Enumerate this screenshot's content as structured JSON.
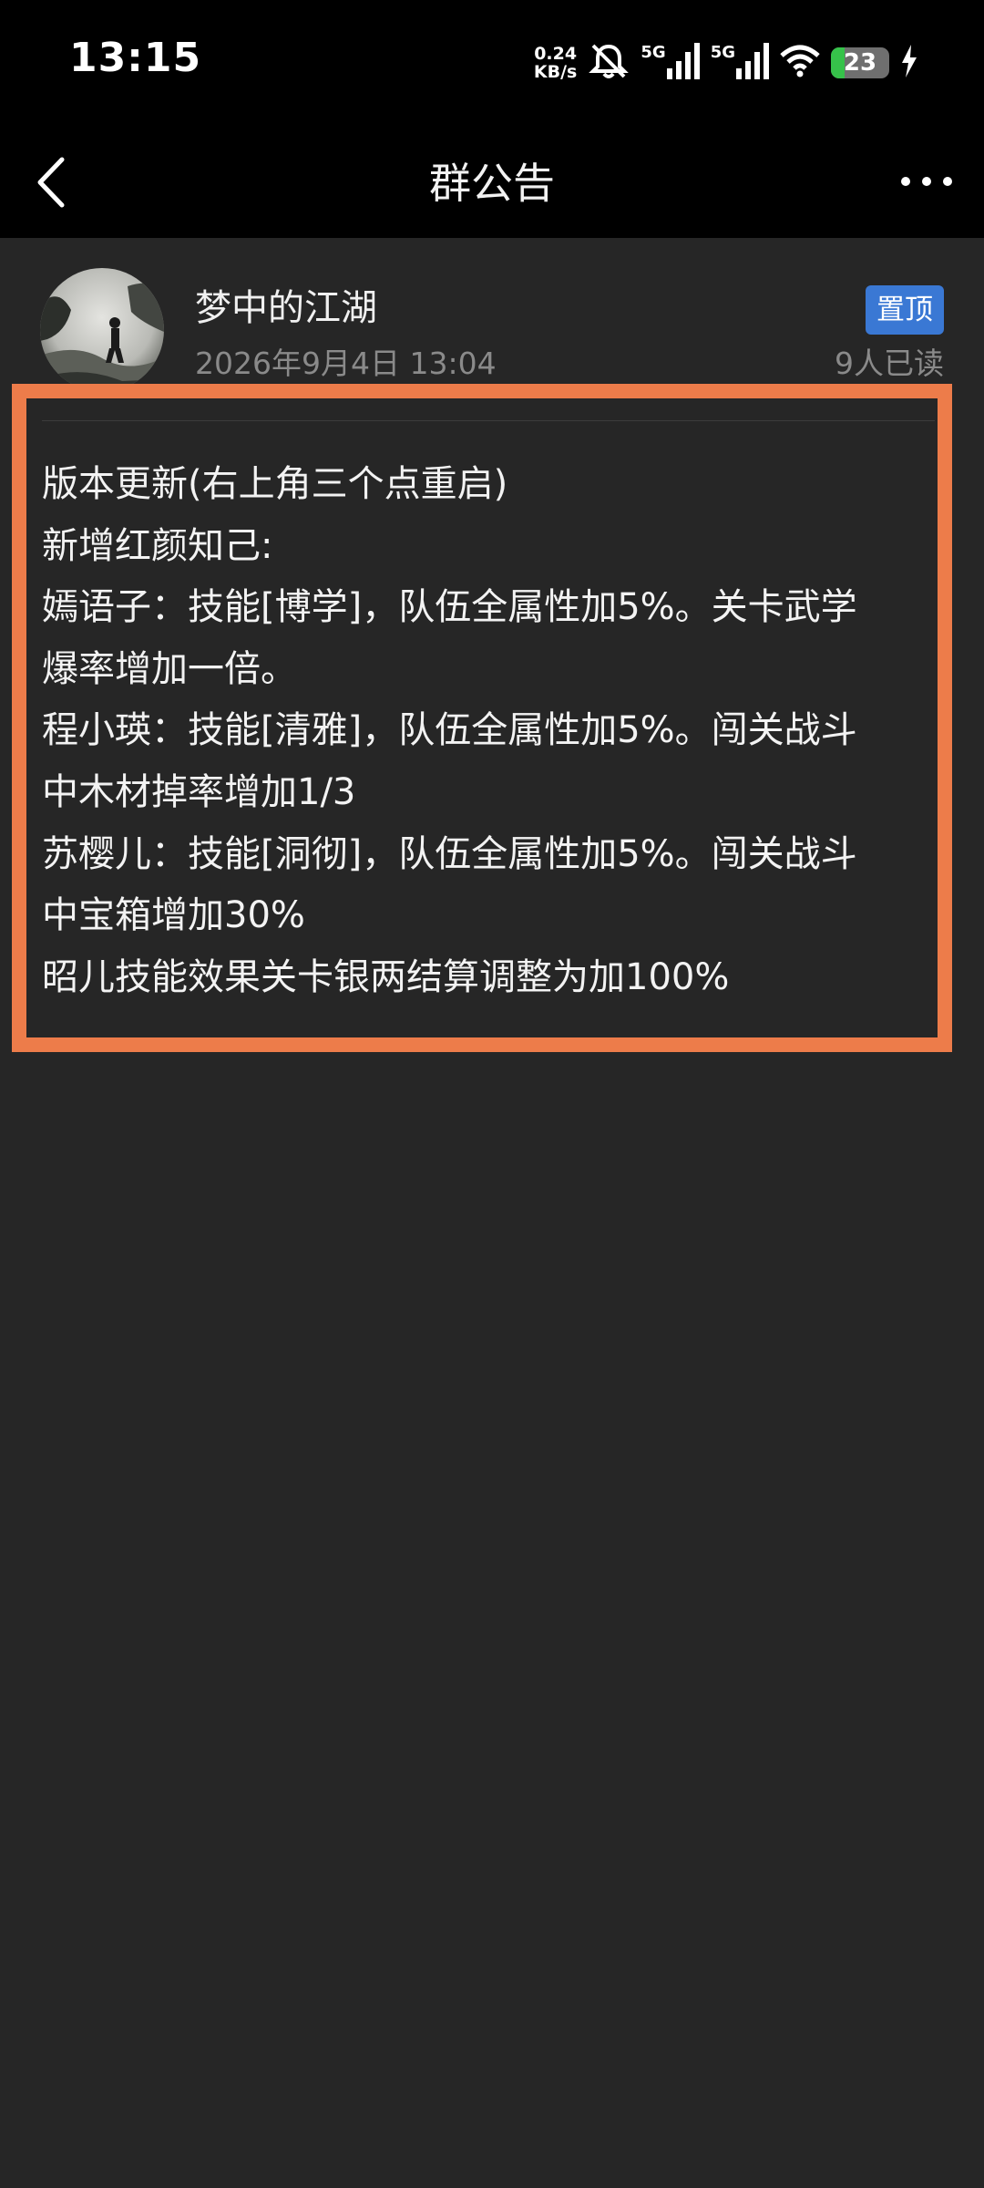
{
  "status_bar": {
    "time": "13:15",
    "net_speed_value": "0.24",
    "net_speed_unit": "KB/s",
    "signal_1_label": "5G",
    "signal_2_label": "5G",
    "battery_level": "23",
    "icons": [
      "mute-bell-icon",
      "signal-icon",
      "signal-icon",
      "wifi-icon",
      "battery-icon",
      "charging-icon"
    ]
  },
  "nav": {
    "title": "群公告",
    "back_icon": "back-chevron-icon",
    "more_icon": "more-dots-icon"
  },
  "announcement": {
    "author": "梦中的江湖",
    "date": "2026年9月4日 13:04",
    "pin_label": "置顶",
    "read_count": "9人已读",
    "lines": [
      "版本更新(右上角三个点重启)",
      "新增红颜知己:",
      "嫣语子：技能[博学]，队伍全属性加5%。关卡武学",
      "爆率增加一倍。",
      "程小瑛：技能[清雅]，队伍全属性加5%。闯关战斗",
      "中木材掉率增加1/3",
      "苏樱儿：技能[洞彻]，队伍全属性加5%。闯关战斗",
      "中宝箱增加30%",
      "昭儿技能效果关卡银两结算调整为加100%"
    ]
  },
  "colors": {
    "background": "#262626",
    "bar": "#000000",
    "highlight_border": "#ed7c4a",
    "badge": "#3a78d4",
    "battery_fill": "#36c24a"
  }
}
